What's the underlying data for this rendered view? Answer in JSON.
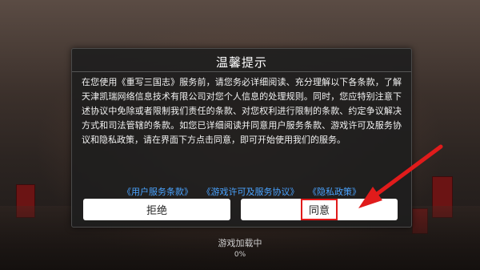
{
  "dialog": {
    "title": "温馨提示",
    "body": "在您使用《重写三国志》服务前，请您务必详细阅读、充分理解以下各条款，了解天津凯瑞网络信息技术有限公司对您个人信息的处理规则。同时，您应特别注意下述协议中免除或者限制我们责任的条款、对您权利进行限制的条款、约定争议解决方式和司法管辖的条款。如您已详细阅读并同意用户服务条款、游戏许可及服务协议和隐私政策，请在界面下方点击同意，即可开始使用我们的服务。",
    "links": {
      "user_terms": "《用户服务条款》",
      "game_license": "《游戏许可及服务协议》",
      "privacy": "《隐私政策》"
    },
    "buttons": {
      "refuse": "拒绝",
      "agree": "同意"
    }
  },
  "loading": {
    "label": "游戏加载中",
    "percent": "0%"
  },
  "colors": {
    "link": "#4aa3ff",
    "highlight": "#e01b1b"
  },
  "icons": [
    "red-arrow-annotation-icon"
  ]
}
